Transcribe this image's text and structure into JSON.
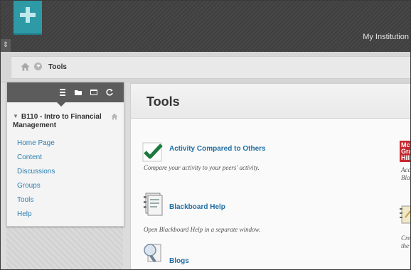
{
  "header": {
    "institution_link": "My Institution",
    "side_handle_glyph": "⇕",
    "brand_color": "#2e9aa5"
  },
  "breadcrumb": {
    "current": "Tools",
    "icons": [
      "home-icon",
      "chevron-down-icon"
    ]
  },
  "course_menu": {
    "toolbar_icons": [
      "list-view-icon",
      "folder-view-icon",
      "window-icon",
      "refresh-icon"
    ],
    "course_title": "B110 - Intro to Financial Management",
    "collapse_glyph": "▼",
    "items": [
      {
        "label": "Home Page"
      },
      {
        "label": "Content"
      },
      {
        "label": "Discussions"
      },
      {
        "label": "Groups"
      },
      {
        "label": "Tools"
      },
      {
        "label": "Help"
      }
    ],
    "link_color": "#2d7fb0"
  },
  "main": {
    "title": "Tools",
    "tools": [
      {
        "name": "Activity Compared to Others",
        "description": "Compare your activity to your peers' activity.",
        "icon": "checkmark-icon"
      },
      {
        "name": "Blackboard Help",
        "description": "Open Blackboard Help in a separate window.",
        "icon": "help-book-icon"
      },
      {
        "name": "Blogs",
        "description": "",
        "icon": "blogs-icon"
      }
    ],
    "right_column": [
      {
        "icon": "mcgraw-hill-icon",
        "logo_text": [
          "Mc",
          "Gra",
          "Hill"
        ],
        "description_lines": [
          "Acc",
          "Bla"
        ]
      },
      {
        "icon": "notebook-icon",
        "description_lines": [
          "Cre",
          "the"
        ]
      }
    ],
    "link_color": "#1f6ea3"
  }
}
